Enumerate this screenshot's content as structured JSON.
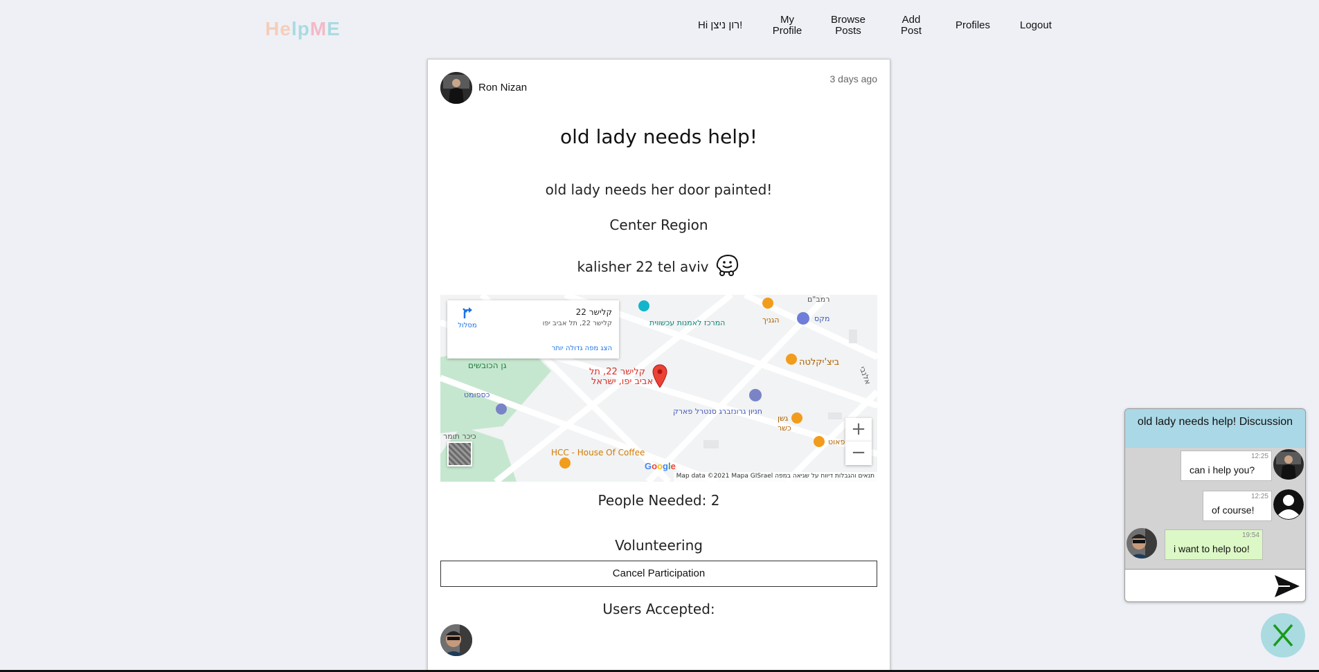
{
  "app": {
    "logo": {
      "h": "H",
      "e": "e",
      "l": "l",
      "p": "p",
      "m": "M",
      "e2": "E"
    }
  },
  "nav": {
    "greeting": "Hi רון ניצן!",
    "my_profile": [
      "My",
      "Profile"
    ],
    "browse_posts": [
      "Browse",
      "Posts"
    ],
    "add_post": [
      "Add",
      "Post"
    ],
    "profiles": "Profiles",
    "logout": "Logout"
  },
  "post": {
    "author": "Ron Nizan",
    "time": "3 days ago",
    "title": "old lady needs help!",
    "description": "old lady needs her door painted!",
    "region": "Center Region",
    "address": "kalisher 22 tel aviv",
    "people_needed": "People Needed: 2",
    "volunteering_label": "Volunteering",
    "cancel_label": "Cancel Participation",
    "users_accepted_label": "Users Accepted:"
  },
  "map": {
    "info_title": "קלישר 22",
    "info_sub": "קלישר 22, תל אביב יפו",
    "info_link": "הצג מפה גדולה יותר",
    "route_label": "מסלול",
    "marker_label_1": "קלישר 22, תל",
    "marker_label_2": "אביב יפו, ישראל",
    "labels": {
      "center_art": "המרכז לאמנות עכשווית",
      "ganich": "הגניך",
      "mekes": "מקס",
      "ramban": "רמב\"ם",
      "gan_hakovshim": "גן הכובשים",
      "kaspomat": "כספומט",
      "kikar": "כיכר תומר",
      "bitzikleta": "ביצ'יקלטה",
      "parking": "חניון גרונזברג סנטרל פארק",
      "geshen": "גשן",
      "kasher": "כשר",
      "safaut": "ספאוט",
      "hcc": "HCC - House Of Coffee",
      "allenby": "אלנבי"
    },
    "zoom_in": "+",
    "zoom_out": "−",
    "google": "Google",
    "footer": "Map data ©2021 Mapa GISrael    תנאים והגבלות    דיווח על שגיאה במפה"
  },
  "chat": {
    "title": "old lady needs help! Discussion",
    "messages": [
      {
        "time": "12:25",
        "text": "can i help you?"
      },
      {
        "time": "12:25",
        "text": "of course!"
      },
      {
        "time": "19:54",
        "text": "i want to help too!"
      }
    ],
    "input_placeholder": ""
  },
  "colors": {
    "logo_peach": "#f6cdb9",
    "logo_teal": "#a9dbe1",
    "logo_pink": "#f3b9c6",
    "chat_header": "#aad8e6",
    "own_message": "#dcf8c6",
    "close_btn": "#a9dbe1",
    "close_x": "#1a9a1a"
  },
  "icons": {
    "waze": "waze-icon",
    "send": "send-icon",
    "close": "close-icon",
    "route": "directions-icon",
    "marker": "map-pin-icon"
  }
}
